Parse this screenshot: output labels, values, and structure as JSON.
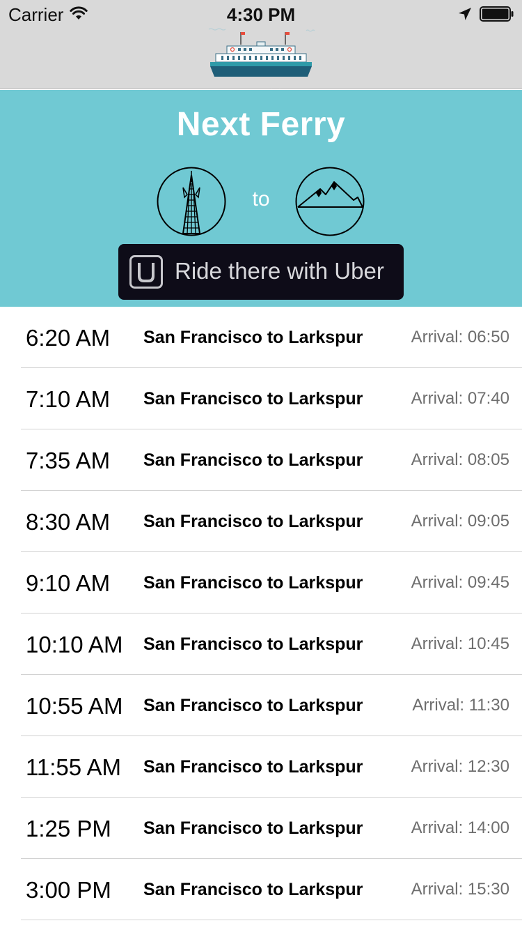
{
  "status_bar": {
    "carrier": "Carrier",
    "time": "4:30 PM",
    "icons": [
      "wifi-icon",
      "location-arrow-icon",
      "battery-icon"
    ]
  },
  "nav": {
    "logo": "ferry-boat-logo"
  },
  "header": {
    "title": "Next Ferry",
    "from_icon": "transamerica-pyramid-icon",
    "connector": "to",
    "to_icon": "mountain-icon",
    "uber_button": {
      "label": "Ride there with Uber",
      "icon": "uber-logo-icon"
    }
  },
  "colors": {
    "header_bg": "#70c9d3",
    "topbar_bg": "#d9d9d9",
    "uber_button_bg": "#0e0c18",
    "arrival_text": "#6e6e6e"
  },
  "schedule": [
    {
      "departure": "6:20 AM",
      "route": "San Francisco to Larkspur",
      "arrival": "Arrival: 06:50"
    },
    {
      "departure": "7:10 AM",
      "route": "San Francisco to Larkspur",
      "arrival": "Arrival: 07:40"
    },
    {
      "departure": "7:35 AM",
      "route": "San Francisco to Larkspur",
      "arrival": "Arrival: 08:05"
    },
    {
      "departure": "8:30 AM",
      "route": "San Francisco to Larkspur",
      "arrival": "Arrival: 09:05"
    },
    {
      "departure": "9:10 AM",
      "route": "San Francisco to Larkspur",
      "arrival": "Arrival: 09:45"
    },
    {
      "departure": "10:10 AM",
      "route": "San Francisco to Larkspur",
      "arrival": "Arrival: 10:45"
    },
    {
      "departure": "10:55 AM",
      "route": "San Francisco to Larkspur",
      "arrival": "Arrival: 11:30"
    },
    {
      "departure": "11:55 AM",
      "route": "San Francisco to Larkspur",
      "arrival": "Arrival: 12:30"
    },
    {
      "departure": "1:25 PM",
      "route": "San Francisco to Larkspur",
      "arrival": "Arrival: 14:00"
    },
    {
      "departure": "3:00 PM",
      "route": "San Francisco to Larkspur",
      "arrival": "Arrival: 15:30"
    }
  ]
}
